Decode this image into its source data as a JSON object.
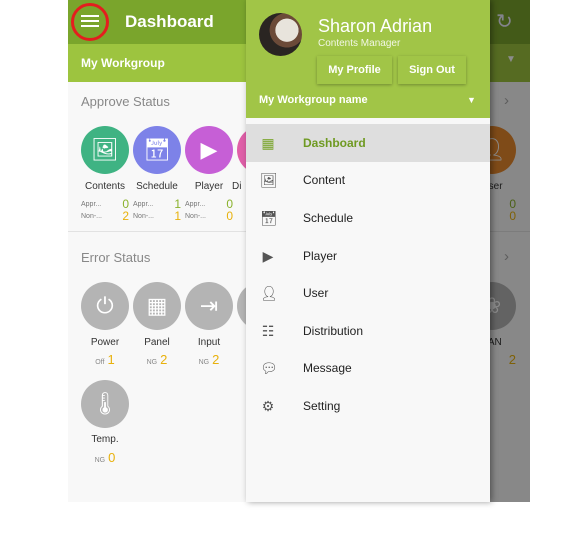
{
  "header": {
    "title": "Dashboard",
    "workgroup": "My Workgroup"
  },
  "approve": {
    "title": "Approve Status",
    "approved_label": "Appr...",
    "non_label": "Non-...",
    "items": [
      {
        "label": "Contents",
        "approved": "0",
        "non": "2",
        "color": "#3fb383",
        "icon": "image-icon"
      },
      {
        "label": "Schedule",
        "approved": "1",
        "non": "1",
        "color": "#7d82e8",
        "icon": "calendar-icon"
      },
      {
        "label": "Player",
        "approved": "0",
        "non": "0",
        "color": "#c65fd6",
        "icon": "player-icon"
      },
      {
        "label": "Di",
        "color": "#e05fa8"
      },
      {
        "label": "User",
        "approved": "0",
        "non": "0",
        "color": "#e8892c",
        "icon": "user-icon"
      }
    ]
  },
  "error": {
    "title": "Error Status",
    "items": [
      {
        "label": "Power",
        "status": "Off",
        "value": "1",
        "icon": "power-icon"
      },
      {
        "label": "Panel",
        "status": "NG",
        "value": "2",
        "icon": "panel-icon"
      },
      {
        "label": "Input",
        "status": "NG",
        "value": "2",
        "icon": "input-icon"
      },
      {
        "label": "FAN",
        "value": "2",
        "icon": "fan-icon"
      },
      {
        "label": "Temp.",
        "status": "NG",
        "value": "0",
        "icon": "thermometer-icon"
      }
    ]
  },
  "drawer": {
    "user_name": "Sharon Adrian",
    "user_role": "Contents Manager",
    "my_profile": "My Profile",
    "sign_out": "Sign Out",
    "workgroup": "My Workgroup name",
    "menu": [
      {
        "label": "Dashboard",
        "icon": "dashboard-icon",
        "active": true
      },
      {
        "label": "Content",
        "icon": "content-icon"
      },
      {
        "label": "Schedule",
        "icon": "schedule-icon"
      },
      {
        "label": "Player",
        "icon": "player-icon"
      },
      {
        "label": "User",
        "icon": "user-icon"
      },
      {
        "label": "Distribution",
        "icon": "distribution-icon"
      },
      {
        "label": "Message",
        "icon": "message-icon"
      },
      {
        "label": "Setting",
        "icon": "setting-icon"
      }
    ]
  },
  "colors": {
    "header": "#7aa52c",
    "accent": "#a1c547",
    "approved": "#8ab22c",
    "warning": "#e8b10c",
    "highlight_ring": "#e41e1e"
  }
}
